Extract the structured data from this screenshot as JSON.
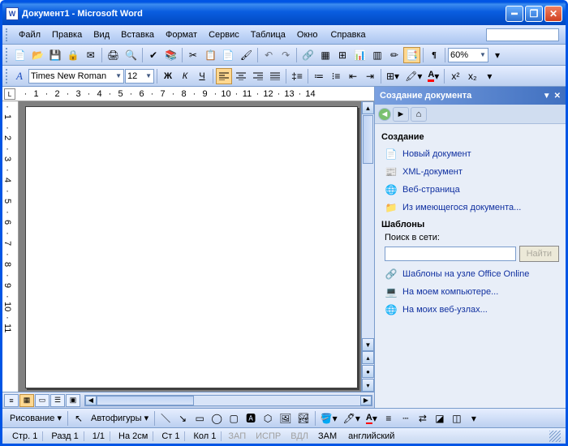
{
  "title": "Документ1 - Microsoft Word",
  "app_icon_letter": "W",
  "menu": {
    "file": "Файл",
    "edit": "Правка",
    "view": "Вид",
    "insert": "Вставка",
    "format": "Формат",
    "tools": "Сервис",
    "table": "Таблица",
    "window": "Окно",
    "help": "Справка"
  },
  "toolbar1": {
    "zoom": "60%"
  },
  "toolbar2": {
    "font": "Times New Roman",
    "size": "12",
    "bold": "Ж",
    "italic": "К",
    "underline": "Ч",
    "super": "x²",
    "sub": "x₂"
  },
  "ruler_corner": "L",
  "ruler_ticks": [
    "",
    "1",
    "",
    "2",
    "",
    "3",
    "",
    "4",
    "",
    "5",
    "",
    "6",
    "",
    "7",
    "",
    "8",
    "",
    "9",
    "",
    "10",
    "",
    "11",
    "",
    "12",
    "",
    "13",
    "",
    "14"
  ],
  "vruler_ticks": [
    "",
    "1",
    "",
    "2",
    "",
    "3",
    "",
    "4",
    "",
    "5",
    "",
    "6",
    "",
    "7",
    "",
    "8",
    "",
    "9",
    "",
    "10",
    "",
    "11"
  ],
  "taskpane": {
    "title": "Создание документа",
    "section1": "Создание",
    "links1": [
      {
        "icon": "📄",
        "label": "Новый документ"
      },
      {
        "icon": "📰",
        "label": "XML-документ"
      },
      {
        "icon": "🌐",
        "label": "Веб-страница"
      },
      {
        "icon": "📁",
        "label": "Из имеющегося документа..."
      }
    ],
    "section2": "Шаблоны",
    "search_label": "Поиск в сети:",
    "search_btn": "Найти",
    "links2": [
      {
        "icon": "🔗",
        "label": "Шаблоны на узле Office Online"
      },
      {
        "icon": "💻",
        "label": "На моем компьютере..."
      },
      {
        "icon": "🌐",
        "label": "На моих веб-узлах..."
      }
    ]
  },
  "drawbar": {
    "drawing": "Рисование",
    "autoshapes": "Автофигуры"
  },
  "status": {
    "page": "Стр. 1",
    "sect": "Разд 1",
    "pages": "1/1",
    "at": "На 2см",
    "line": "Ст 1",
    "col": "Кол 1",
    "rec": "ЗАП",
    "trk": "ИСПР",
    "ext": "ВДЛ",
    "ovr": "ЗАМ",
    "lang": "английский"
  }
}
